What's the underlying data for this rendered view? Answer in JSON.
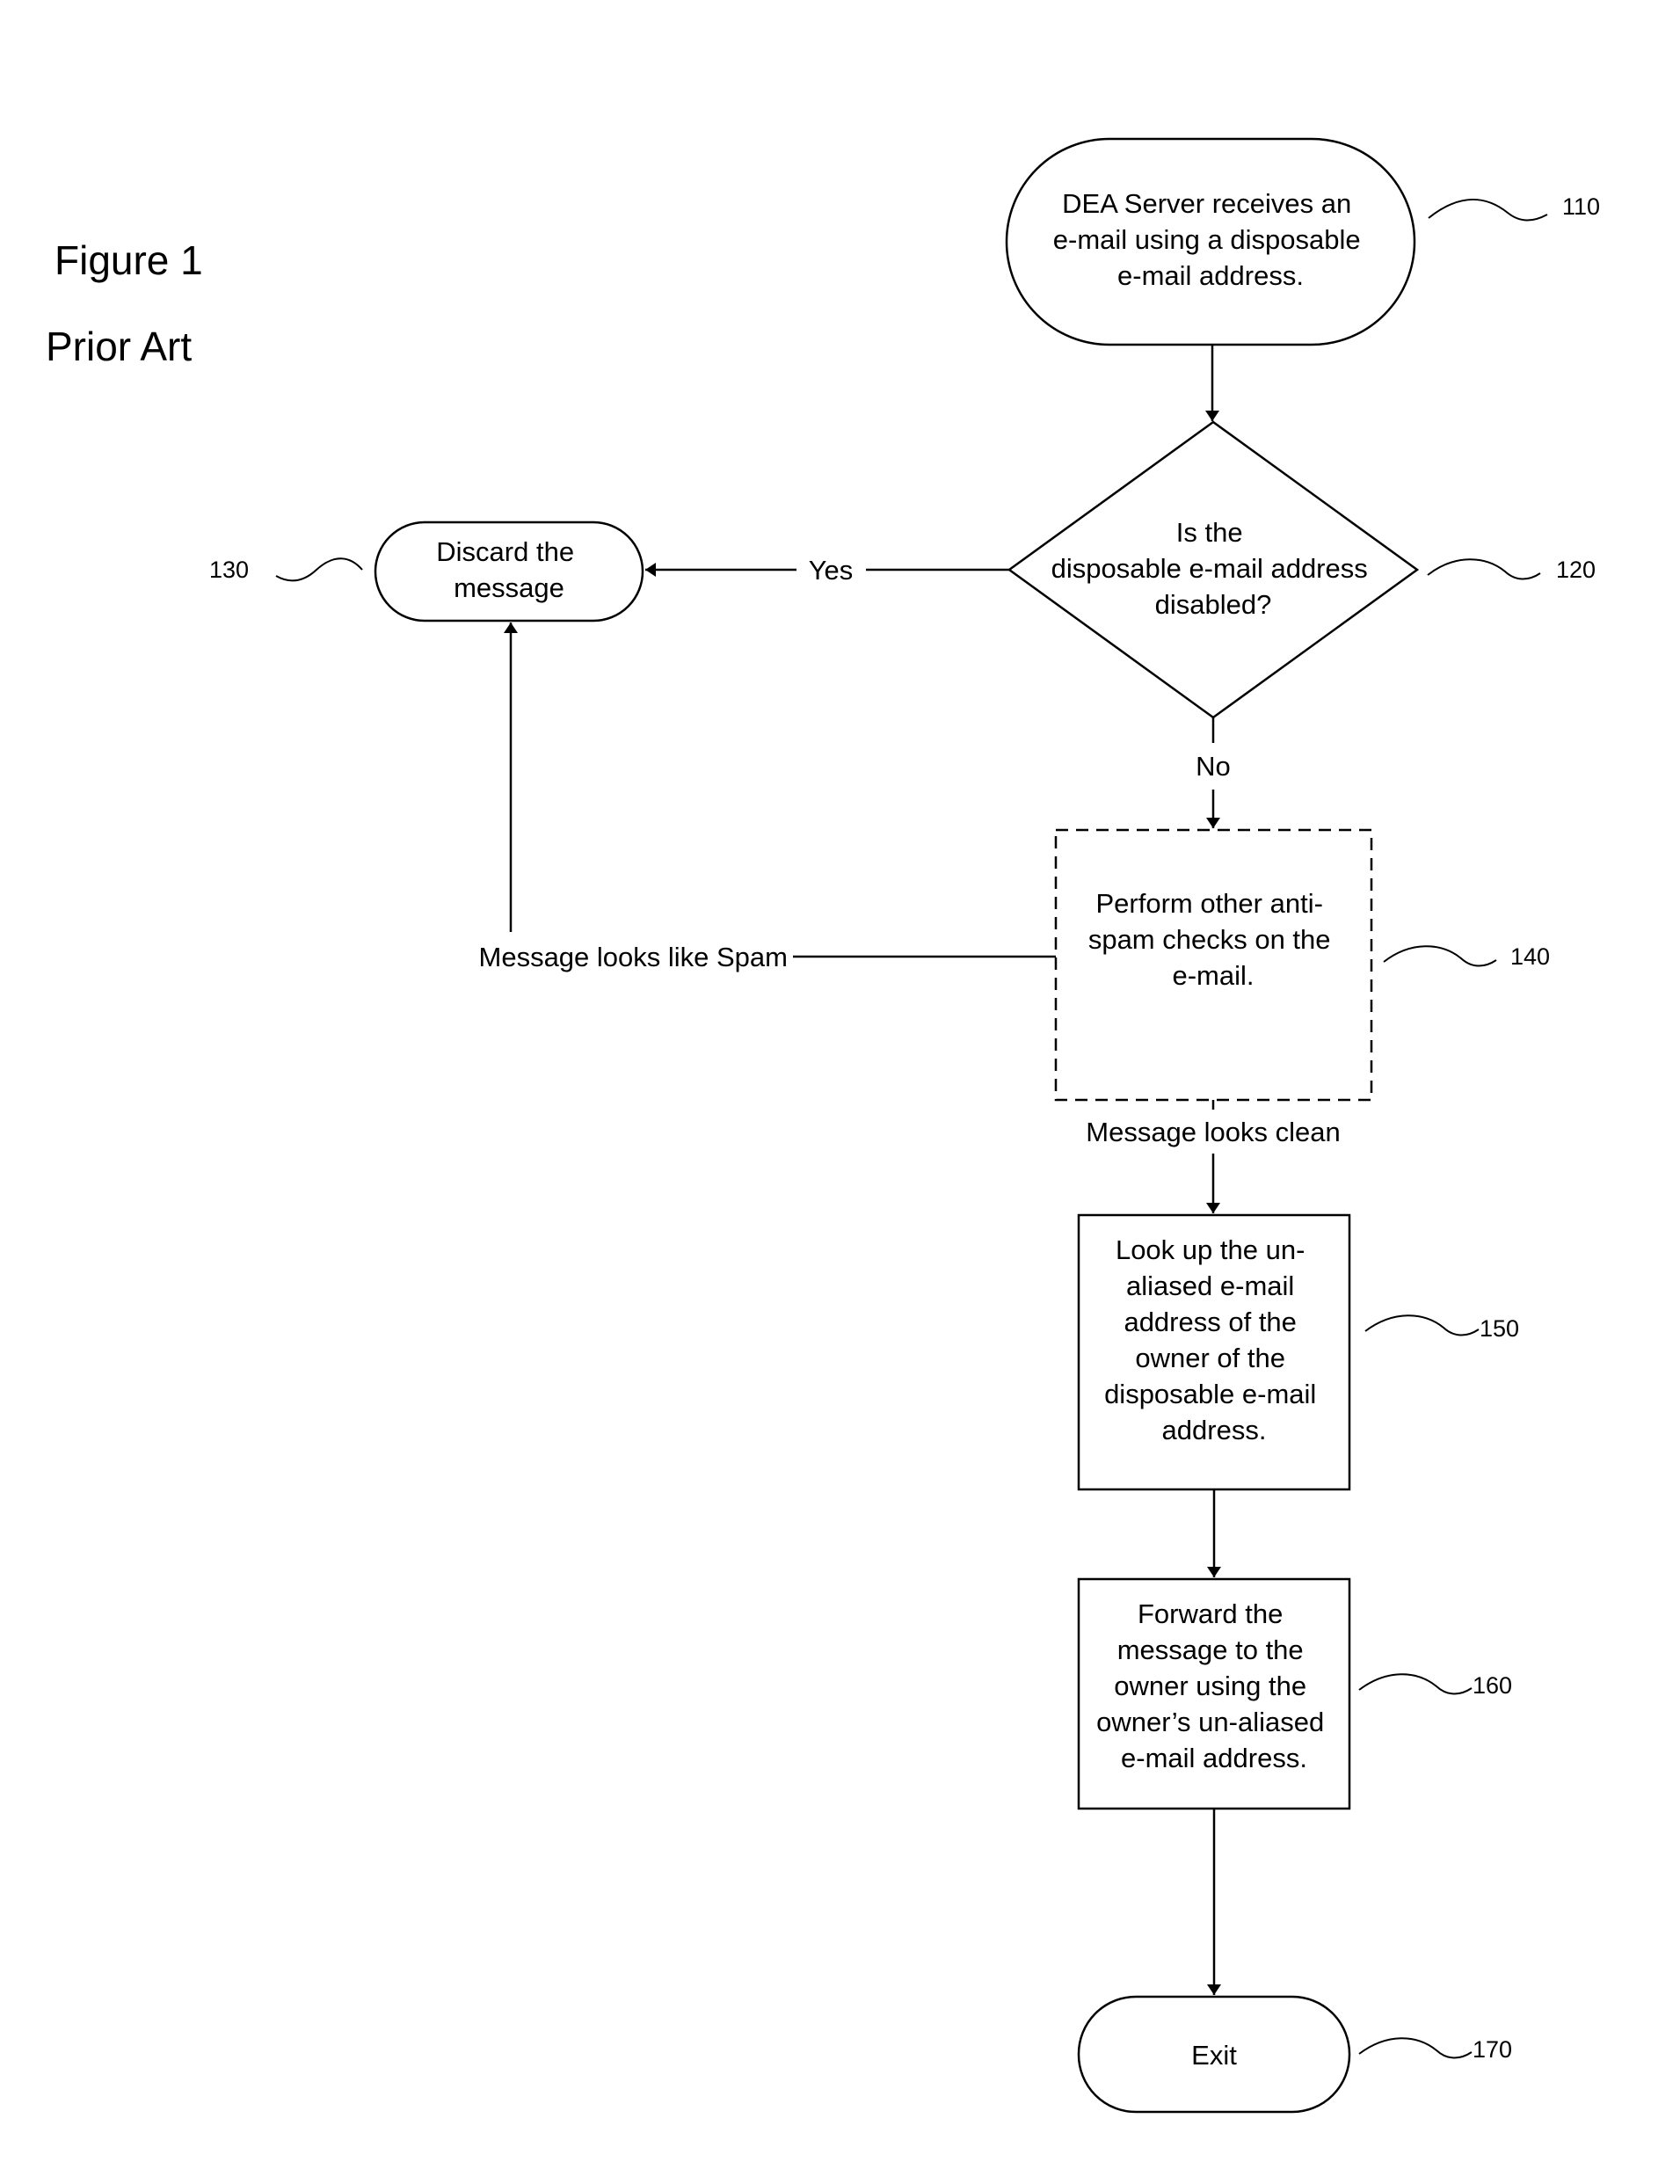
{
  "figure": {
    "title": "Figure 1",
    "subtitle": "Prior Art"
  },
  "nodes": {
    "n110": {
      "ref": "110",
      "shape": "terminal",
      "lines": [
        "DEA Server receives an",
        "e-mail using a disposable",
        "e-mail address."
      ]
    },
    "n120": {
      "ref": "120",
      "shape": "decision",
      "lines": [
        "Is the",
        "disposable e-mail address",
        "disabled?"
      ]
    },
    "n130": {
      "ref": "130",
      "shape": "terminal",
      "lines": [
        "Discard the",
        "message"
      ]
    },
    "n140": {
      "ref": "140",
      "shape": "process-dashed",
      "lines": [
        "Perform other anti-",
        "spam checks on the",
        "e-mail."
      ]
    },
    "n150": {
      "ref": "150",
      "shape": "process",
      "lines": [
        "Look up the un-",
        "aliased e-mail",
        "address of the",
        "owner of the",
        "disposable e-mail",
        "address."
      ]
    },
    "n160": {
      "ref": "160",
      "shape": "process",
      "lines": [
        "Forward the",
        "message to the",
        "owner using the",
        "owner’s un-aliased",
        "e-mail address."
      ]
    },
    "n170": {
      "ref": "170",
      "shape": "terminal",
      "lines": [
        "Exit"
      ]
    }
  },
  "edges": {
    "yes": {
      "from": "120",
      "to": "130",
      "label": "Yes"
    },
    "no": {
      "from": "120",
      "to": "140",
      "label": "No"
    },
    "spam": {
      "from": "140",
      "to": "130",
      "label": "Message looks like Spam"
    },
    "clean": {
      "from": "140",
      "to": "150",
      "label": "Message looks clean"
    },
    "e110_120": {
      "from": "110",
      "to": "120",
      "label": ""
    },
    "e150_160": {
      "from": "150",
      "to": "160",
      "label": ""
    },
    "e160_170": {
      "from": "160",
      "to": "170",
      "label": ""
    }
  }
}
